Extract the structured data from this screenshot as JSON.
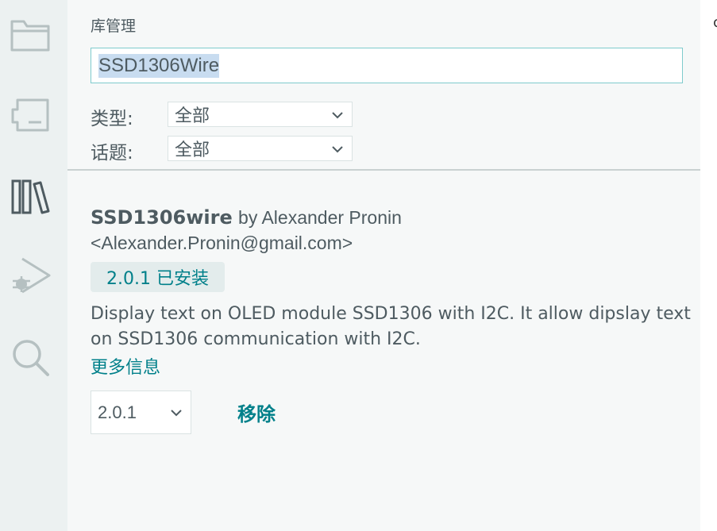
{
  "activity_bar": {
    "icons": [
      "folder-icon",
      "board-icon",
      "library-icon",
      "debug-icon",
      "search-icon"
    ],
    "active_icon": "library-icon"
  },
  "panel": {
    "title": "库管理",
    "search": {
      "value": "SSD1306Wire"
    },
    "filters": {
      "type": {
        "label": "类型:",
        "value": "全部"
      },
      "topic": {
        "label": "话题:",
        "value": "全部"
      }
    }
  },
  "library": {
    "name": "SSD1306wire",
    "by": "by Alexander Pronin",
    "email": "<Alexander.Pronin@gmail.com>",
    "installed_badge": "2.0.1 已安装",
    "description": "Display text on OLED module SSD1306 with I2C. It allow dipslay text on SSD1306 communication with I2C.",
    "more_info": "更多信息",
    "version": "2.0.1",
    "remove_label": "移除"
  },
  "right_strip": {
    "text": "c"
  },
  "colors": {
    "accent": "#00808a",
    "text": "#4e5b61",
    "icon": "#b5c0c1",
    "active_icon": "#4e5b61",
    "panel_bg": "#f6f8f8",
    "activity_bg": "#ecf1f1",
    "input_border": "#7fcbcd",
    "selection": "#c8dcf0"
  }
}
